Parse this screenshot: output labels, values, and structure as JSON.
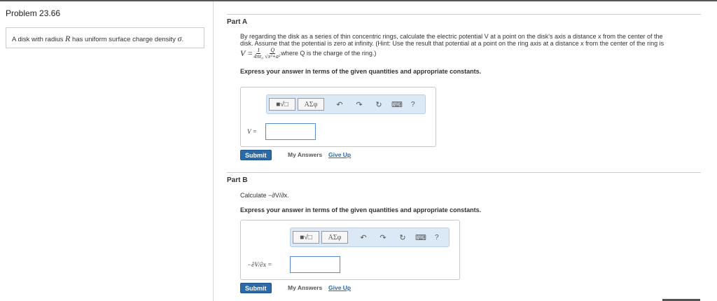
{
  "problem": {
    "title": "Problem 23.66",
    "statement_pre": "A disk with radius ",
    "statement_R": "R",
    "statement_mid": " has uniform surface charge density ",
    "statement_sigma": "σ",
    "statement_end": "."
  },
  "partA": {
    "label": "Part A",
    "desc1": "By regarding the disk as a series of thin concentric rings, calculate the electric potential V at a point on the disk's axis a distance x from the center of the",
    "desc2": "disk. Assume that the potential is zero at infinity. (Hint: Use the result that potential at a point on the ring axis at a distance x from the center of the ring is",
    "formula_lhs": "V =",
    "formula_frac1_num": "1",
    "formula_frac1_den": "4πε₀",
    "formula_frac2_num": "Q",
    "formula_frac2_den": "√x²+a²",
    "formula_tail": " where Q is the charge of the ring.)",
    "express": "Express your answer in terms of the given quantities and appropriate constants.",
    "answer_label": "V =",
    "submit": "Submit",
    "my_answers": "My Answers",
    "give_up": "Give Up"
  },
  "partB": {
    "label": "Part B",
    "question": "Calculate −∂V/∂x.",
    "express": "Express your answer in terms of the given quantities and appropriate constants.",
    "answer_label": "−∂V/∂x =",
    "submit": "Submit",
    "my_answers": "My Answers",
    "give_up": "Give Up"
  },
  "toolbar": {
    "template_btn": "■√□",
    "greek_btn": "ΑΣφ",
    "undo_icon": "↶",
    "redo_icon": "↷",
    "reset_icon": "↻",
    "keyboard_icon": "⌨",
    "help": "?"
  }
}
